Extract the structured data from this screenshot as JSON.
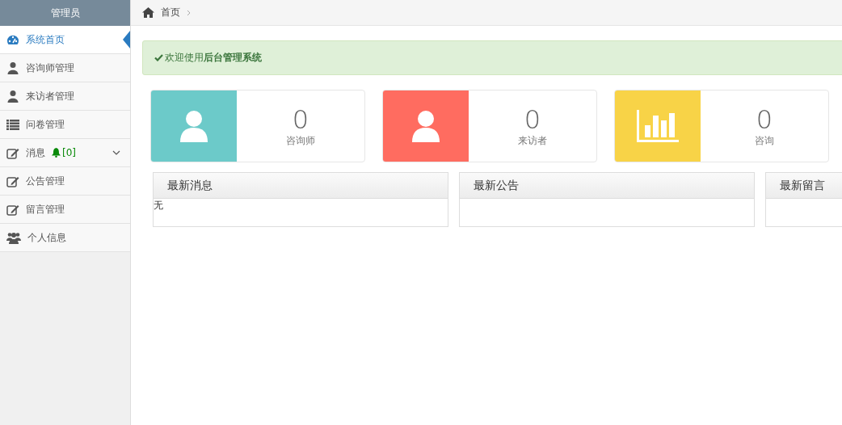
{
  "sidebar": {
    "title": "管理员",
    "items": [
      {
        "label": "系统首页",
        "selected": true
      },
      {
        "label": "咨询师管理",
        "selected": false
      },
      {
        "label": "来访者管理",
        "selected": false
      },
      {
        "label": "问卷管理",
        "selected": false
      },
      {
        "label": "消息",
        "selected": false,
        "badge": "[0]",
        "expandable": true
      },
      {
        "label": "公告管理",
        "selected": false
      },
      {
        "label": "留言管理",
        "selected": false
      },
      {
        "label": "个人信息",
        "selected": false
      }
    ]
  },
  "breadcrumb": {
    "label": "首页"
  },
  "alert": {
    "text": "欢迎使用**后台管理系统**"
  },
  "stats": [
    {
      "value": "0",
      "label": "咨询师",
      "color": "#6ccac9"
    },
    {
      "value": "0",
      "label": "来访者",
      "color": "#ff6c60"
    },
    {
      "value": "0",
      "label": "咨询",
      "color": "#f8d347"
    }
  ],
  "panels": [
    {
      "title": "最新消息",
      "body": "无"
    },
    {
      "title": "最新公告"
    },
    {
      "title": "最新留言"
    }
  ]
}
